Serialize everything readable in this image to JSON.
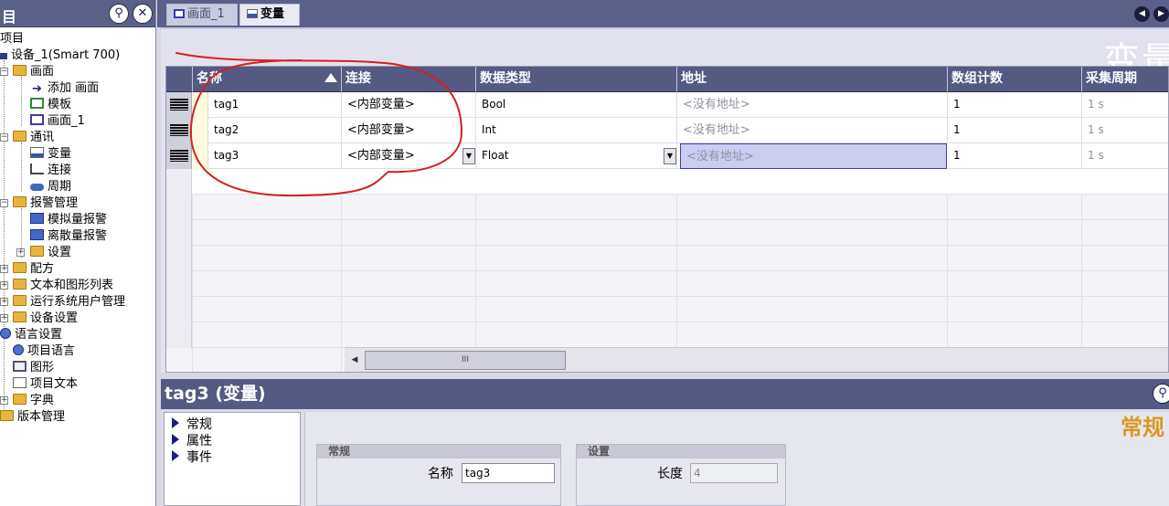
{
  "tree": {
    "title": "目",
    "pin_icon": "pin-icon",
    "close_icon": "close-icon",
    "items": [
      {
        "label": "项目",
        "icon": "none"
      },
      {
        "label": "设备_1(Smart 700)",
        "icon": "device-icon"
      },
      {
        "label": "画面",
        "icon": "folder-icon"
      },
      {
        "label": "添加 画面",
        "icon": "add-screen-icon"
      },
      {
        "label": "模板",
        "icon": "template-icon"
      },
      {
        "label": "画面_1",
        "icon": "screen-icon"
      },
      {
        "label": "通讯",
        "icon": "folder-icon"
      },
      {
        "label": "变量",
        "icon": "variable-icon"
      },
      {
        "label": "连接",
        "icon": "connection-icon"
      },
      {
        "label": "周期",
        "icon": "cycle-icon"
      },
      {
        "label": "报警管理",
        "icon": "folder-icon"
      },
      {
        "label": "模拟量报警",
        "icon": "alarm-icon"
      },
      {
        "label": "离散量报警",
        "icon": "alarm-icon"
      },
      {
        "label": "设置",
        "icon": "folder-icon"
      },
      {
        "label": "配方",
        "icon": "folder-icon"
      },
      {
        "label": "文本和图形列表",
        "icon": "folder-icon"
      },
      {
        "label": "运行系统用户管理",
        "icon": "folder-icon"
      },
      {
        "label": "设备设置",
        "icon": "folder-icon"
      },
      {
        "label": "语言设置",
        "icon": "globe-icon"
      },
      {
        "label": "项目语言",
        "icon": "globe-icon"
      },
      {
        "label": "图形",
        "icon": "graphic-icon"
      },
      {
        "label": "项目文本",
        "icon": "text-icon"
      },
      {
        "label": "字典",
        "icon": "folder-icon"
      },
      {
        "label": "版本管理",
        "icon": "folder-icon"
      }
    ]
  },
  "tabs": [
    {
      "label": "画面_1",
      "active": false
    },
    {
      "label": "变量",
      "active": true
    }
  ],
  "editor": {
    "watermark": "变量",
    "columns": [
      "名称",
      "连接",
      "数据类型",
      "地址",
      "数组计数",
      "采集周期"
    ],
    "rows": [
      {
        "name": "tag1",
        "connection": "<内部变量>",
        "type": "Bool",
        "address": "<没有地址>",
        "count": "1",
        "cycle": "1 s"
      },
      {
        "name": "tag2",
        "connection": "<内部变量>",
        "type": "Int",
        "address": "<没有地址>",
        "count": "1",
        "cycle": "1 s"
      },
      {
        "name": "tag3",
        "connection": "<内部变量>",
        "type": "Float",
        "address": "<没有地址>",
        "count": "1",
        "cycle": "1 s"
      }
    ],
    "scroll_thumb": "III"
  },
  "props": {
    "title": "tag3 (变量)",
    "nav": [
      "常规",
      "属性",
      "事件"
    ],
    "big_label": "常规",
    "group_general": {
      "title": "常规",
      "name_label": "名称",
      "name_value": "tag3"
    },
    "group_settings": {
      "title": "设置",
      "length_label": "长度",
      "length_value": "4"
    }
  },
  "colors": {
    "header": "#545a82",
    "annotation": "#d42020",
    "accent": "#d99a20"
  }
}
